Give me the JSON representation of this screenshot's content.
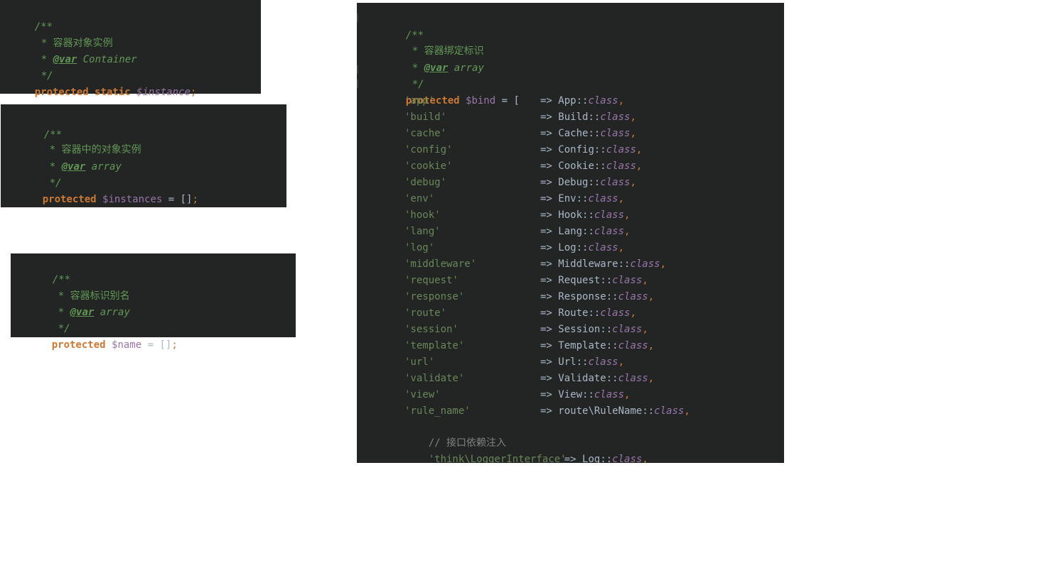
{
  "panel1": {
    "comment_open": "/**",
    "desc_star": "*",
    "desc": "容器对象实例",
    "var_star": "*",
    "var_tag": "@var",
    "var_type": "Container",
    "comment_close": "*/",
    "kw1": "protected",
    "kw2": "static",
    "var_name": "$instance",
    "semi": ";"
  },
  "panel2": {
    "comment_open": "/**",
    "desc_star": "*",
    "desc": "容器中的对象实例",
    "var_star": "*",
    "var_tag": "@var",
    "var_type": "array",
    "comment_close": "*/",
    "kw1": "protected",
    "var_name": "$instances",
    "assign": " = ",
    "value": "[]",
    "semi": ";"
  },
  "panel3": {
    "comment_open": "/**",
    "desc_star": "*",
    "desc": "容器标识别名",
    "var_star": "*",
    "var_tag": "@var",
    "var_type": "array",
    "comment_close": "*/",
    "kw1": "protected",
    "var_name": "$name",
    "assign": " = ",
    "value": "[]",
    "semi": ";"
  },
  "panel4": {
    "comment_open": "/**",
    "desc_star": "*",
    "desc": "容器绑定标识",
    "var_star": "*",
    "var_tag": "@var",
    "var_type": "array",
    "comment_close": "*/",
    "kw1": "protected",
    "var_name": "$bind",
    "assign": " = [",
    "arrow": "=> ",
    "sep": "::",
    "cls_kw": "class",
    "comma": ",",
    "entries": [
      {
        "key": "'app'",
        "cls": "App"
      },
      {
        "key": "'build'",
        "cls": "Build"
      },
      {
        "key": "'cache'",
        "cls": "Cache"
      },
      {
        "key": "'config'",
        "cls": "Config"
      },
      {
        "key": "'cookie'",
        "cls": "Cookie"
      },
      {
        "key": "'debug'",
        "cls": "Debug"
      },
      {
        "key": "'env'",
        "cls": "Env"
      },
      {
        "key": "'hook'",
        "cls": "Hook"
      },
      {
        "key": "'lang'",
        "cls": "Lang"
      },
      {
        "key": "'log'",
        "cls": "Log"
      },
      {
        "key": "'middleware'",
        "cls": "Middleware"
      },
      {
        "key": "'request'",
        "cls": "Request"
      },
      {
        "key": "'response'",
        "cls": "Response"
      },
      {
        "key": "'route'",
        "cls": "Route"
      },
      {
        "key": "'session'",
        "cls": "Session"
      },
      {
        "key": "'template'",
        "cls": "Template"
      },
      {
        "key": "'url'",
        "cls": "Url"
      },
      {
        "key": "'validate'",
        "cls": "Validate"
      },
      {
        "key": "'view'",
        "cls": "View"
      },
      {
        "key": "'rule_name'",
        "cls": "route\\RuleName"
      }
    ],
    "line_comment": "// 接口依赖注入",
    "last_entry": {
      "key": "'think\\LoggerInterface'",
      "cls": "Log"
    },
    "close": "];"
  }
}
